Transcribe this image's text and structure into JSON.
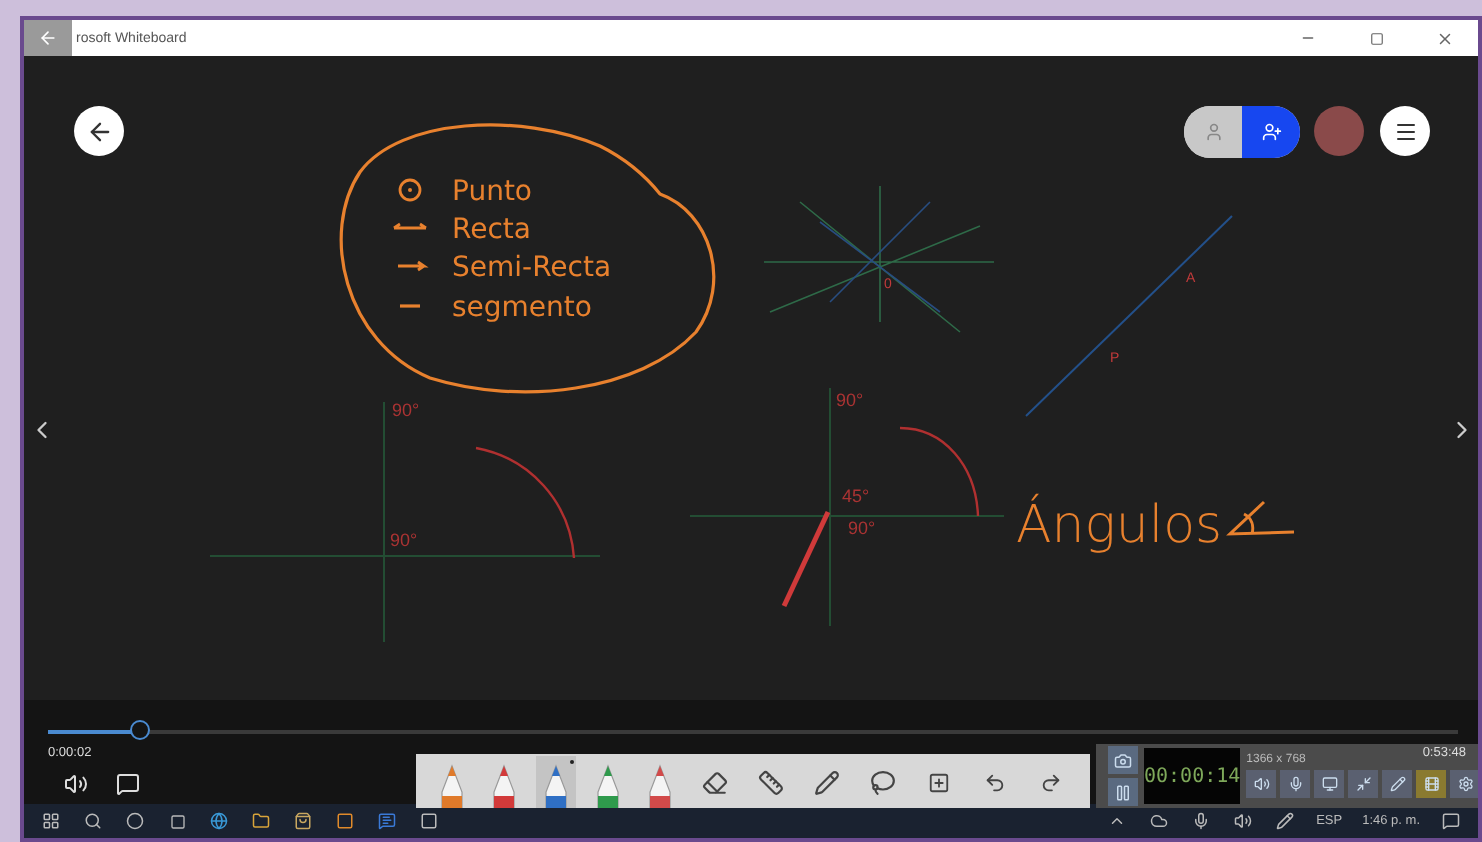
{
  "window": {
    "title": "rosoft Whiteboard"
  },
  "whiteboard": {
    "list_items": [
      {
        "kind": "dot",
        "text": "Punto"
      },
      {
        "kind": "line",
        "text": "Recta"
      },
      {
        "kind": "ray",
        "text": "Semi-Recta"
      },
      {
        "kind": "segment",
        "text": "segmento"
      }
    ],
    "point_labels": [
      "0",
      "A",
      "P"
    ],
    "angle_labels": [
      "90°",
      "90°",
      "90°",
      "45°",
      "90°"
    ],
    "heading": "Ángulos"
  },
  "view_toggle": {
    "options": [
      {
        "selected": false
      },
      {
        "selected": true
      }
    ]
  },
  "player": {
    "progress": {
      "level": 0.065
    },
    "elapsed": "0:00:02",
    "duration": "0:53:48"
  },
  "pen_toolbar": {
    "pens": [
      {
        "color": "#e07a2a",
        "selected": false
      },
      {
        "color": "#d23a3a",
        "selected": false
      },
      {
        "color": "#2f6fc4",
        "selected": true
      },
      {
        "color": "#2f9a4c",
        "selected": false
      },
      {
        "color": "#d24a4a",
        "selected": false
      }
    ]
  },
  "recorder": {
    "timer": "00:00:14",
    "resolution": "1366 x 768"
  },
  "taskbar": {
    "language": "ESP",
    "time": "1:46 p. m."
  }
}
